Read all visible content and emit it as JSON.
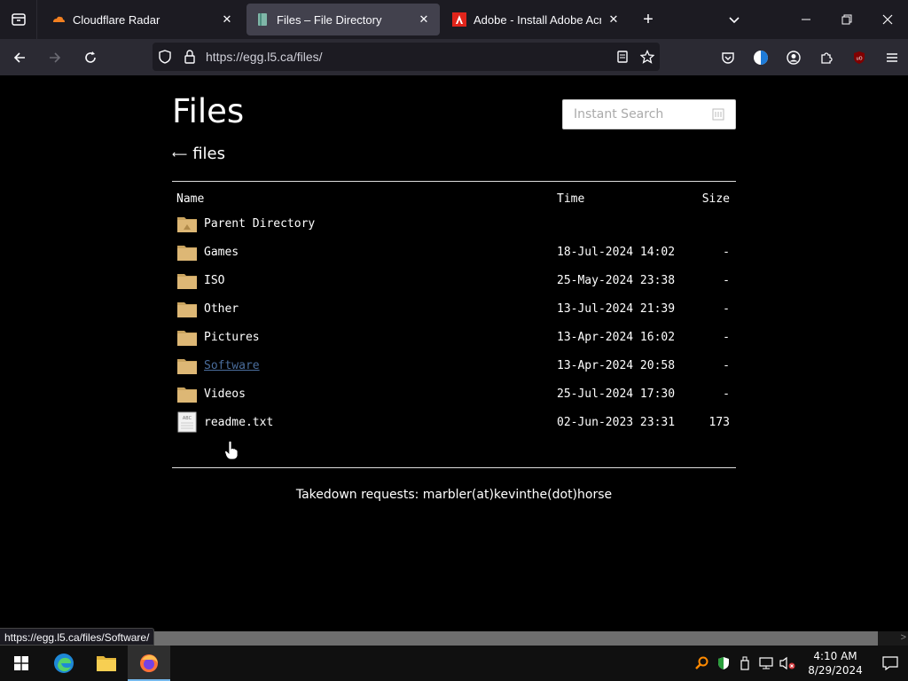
{
  "browser": {
    "tabs": [
      {
        "title": "Cloudflare Radar",
        "active": false
      },
      {
        "title": "Files – File Directory",
        "active": true
      },
      {
        "title": "Adobe - Install Adobe Acrobat",
        "active": false
      }
    ],
    "url": "https://egg.l5.ca/files/",
    "status_url": "https://egg.l5.ca/files/Software/"
  },
  "page": {
    "title": "Files",
    "search_placeholder": "Instant Search",
    "breadcrumb_arrow": "⟵",
    "breadcrumb": "files",
    "columns": {
      "name": "Name",
      "time": "Time",
      "size": "Size"
    },
    "entries": [
      {
        "name": "Parent Directory",
        "time": "",
        "size": "",
        "type": "parent"
      },
      {
        "name": "Games",
        "time": "18-Jul-2024 14:02",
        "size": "-",
        "type": "folder"
      },
      {
        "name": "ISO",
        "time": "25-May-2024 23:38",
        "size": "-",
        "type": "folder"
      },
      {
        "name": "Other",
        "time": "13-Jul-2024 21:39",
        "size": "-",
        "type": "folder"
      },
      {
        "name": "Pictures",
        "time": "13-Apr-2024 16:02",
        "size": "-",
        "type": "folder"
      },
      {
        "name": "Software",
        "time": "13-Apr-2024 20:58",
        "size": "-",
        "type": "folder",
        "hover": true
      },
      {
        "name": "Videos",
        "time": "25-Jul-2024 17:30",
        "size": "-",
        "type": "folder"
      },
      {
        "name": "readme.txt",
        "time": "02-Jun-2023 23:31",
        "size": "173",
        "type": "text",
        "icon_label": "ABC"
      }
    ],
    "footer": "Takedown requests: marbler(at)kevinthe(dot)horse"
  },
  "taskbar": {
    "time": "4:10 AM",
    "date": "8/29/2024"
  },
  "colors": {
    "tab_bg": "#1c1b22",
    "toolbar_bg": "#2b2a33",
    "active_tab": "#42414d",
    "link_hover": "#4a6d9c",
    "page_bg": "#000000"
  }
}
